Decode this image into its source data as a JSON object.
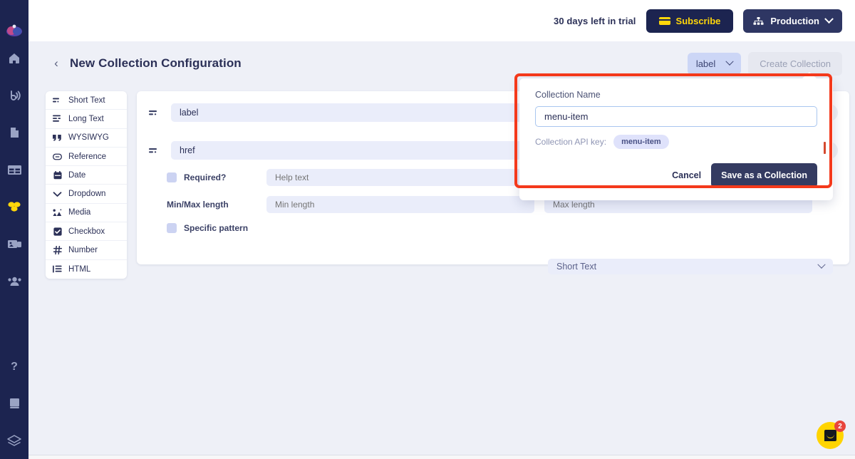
{
  "sidebar": {
    "logo": "app-logo",
    "items": [
      {
        "name": "home-icon",
        "icon": "home",
        "active": false
      },
      {
        "name": "api-icon",
        "icon": "broadcast",
        "active": false
      },
      {
        "name": "pages-icon",
        "icon": "document",
        "active": false
      },
      {
        "name": "tables-icon",
        "icon": "grid",
        "active": false
      },
      {
        "name": "components-icon",
        "icon": "blocks",
        "active": true
      },
      {
        "name": "media-icon",
        "icon": "media",
        "active": false
      },
      {
        "name": "team-icon",
        "icon": "users",
        "active": false
      }
    ],
    "bottom_items": [
      {
        "name": "help-icon",
        "icon": "question",
        "active": false
      },
      {
        "name": "docs-icon",
        "icon": "book",
        "active": false
      },
      {
        "name": "layers-icon",
        "icon": "layers",
        "active": false
      }
    ]
  },
  "topbar": {
    "trial_text": "30 days left in trial",
    "subscribe_label": "Subscribe",
    "environment_label": "Production"
  },
  "header": {
    "title": "New Collection Configuration",
    "back_label": "‹",
    "select_value": "label",
    "create_label": "Create Collection"
  },
  "field_types": [
    {
      "label": "Short Text",
      "icon": "short-text"
    },
    {
      "label": "Long Text",
      "icon": "long-text"
    },
    {
      "label": "WYSIWYG",
      "icon": "quote"
    },
    {
      "label": "Reference",
      "icon": "link"
    },
    {
      "label": "Date",
      "icon": "calendar"
    },
    {
      "label": "Dropdown",
      "icon": "chevron-down"
    },
    {
      "label": "Media",
      "icon": "image"
    },
    {
      "label": "Checkbox",
      "icon": "checkbox"
    },
    {
      "label": "Number",
      "icon": "hash"
    },
    {
      "label": "HTML",
      "icon": "list"
    }
  ],
  "fields": [
    {
      "value": "label",
      "tag": "label",
      "icon": "short-text"
    },
    {
      "value": "href",
      "tag": "href",
      "icon": "short-text"
    }
  ],
  "field_options": {
    "required_label": "Required?",
    "help_text_placeholder": "Help text",
    "minmax_label": "Min/Max length",
    "min_placeholder": "Min length",
    "max_placeholder": "Max length",
    "pattern_label": "Specific pattern",
    "type_value": "Short Text"
  },
  "modal": {
    "name_label": "Collection Name",
    "name_value": "menu-item",
    "api_key_label": "Collection API key:",
    "api_key_value": "menu-item",
    "cancel_label": "Cancel",
    "save_label": "Save as a Collection"
  },
  "chat": {
    "badge": "2"
  },
  "colors": {
    "rail_bg": "#1c2450",
    "page_bg": "#eef0f7",
    "accent_yellow": "#ffd60a",
    "annotation_red": "#f4391b",
    "input_bg": "#eaedfa",
    "text_dark": "#2b3057"
  }
}
